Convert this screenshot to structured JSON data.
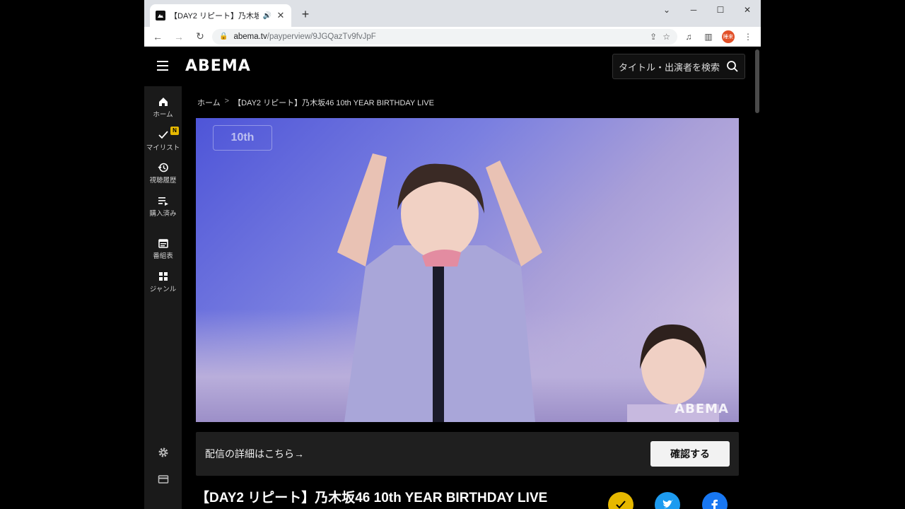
{
  "browser": {
    "tab_title": "【DAY2 リピート】乃木坂46 10th",
    "url_host": "abema.tv",
    "url_path": "/payperview/9JGQazTv9fvJpF",
    "profile_label": "睡来"
  },
  "header": {
    "logo": "ABEMA",
    "search_placeholder": "タイトル・出演者を検索"
  },
  "sidebar": {
    "items": [
      {
        "label": "ホーム",
        "icon": "home-icon"
      },
      {
        "label": "マイリスト",
        "icon": "check-icon",
        "badge": "N"
      },
      {
        "label": "視聴履歴",
        "icon": "history-icon"
      },
      {
        "label": "購入済み",
        "icon": "playlist-icon"
      },
      {
        "label": "番組表",
        "icon": "calendar-icon"
      },
      {
        "label": "ジャンル",
        "icon": "grid-icon"
      }
    ]
  },
  "breadcrumb": {
    "home": "ホーム",
    "current": "【DAY2 リピート】乃木坂46 10th YEAR BIRTHDAY LIVE"
  },
  "video": {
    "watermark": "ABEMA"
  },
  "notice": {
    "text": "配信の詳細はこちら→",
    "button": "確認する"
  },
  "program": {
    "title": "【DAY2 リピート】乃木坂46 10th YEAR BIRTHDAY LIVE"
  },
  "colors": {
    "mylist": "#e6b800",
    "twitter": "#1d9bf0",
    "facebook": "#1877f2"
  }
}
